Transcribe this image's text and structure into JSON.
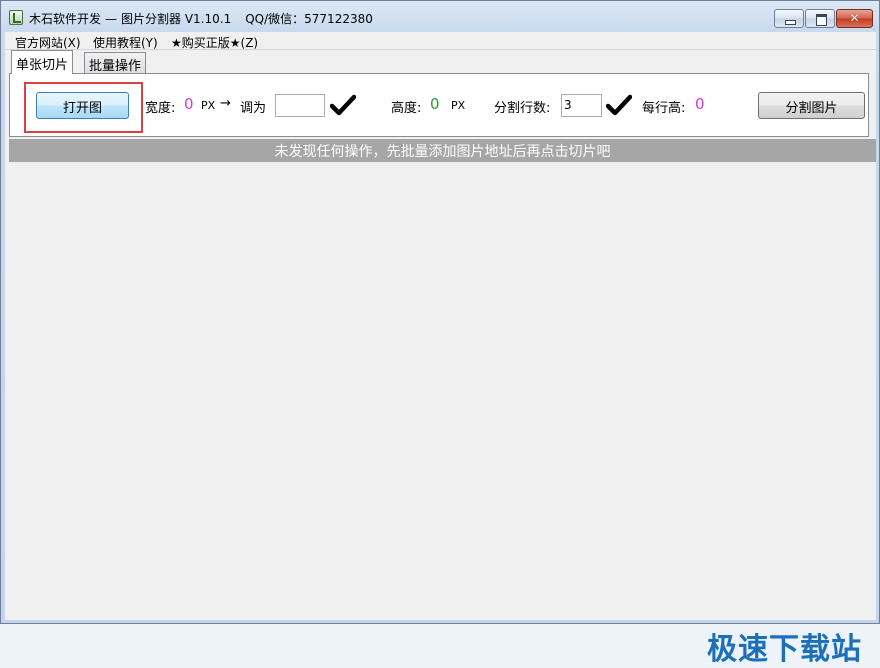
{
  "window": {
    "app_name": "木石软件开发",
    "separator": "—",
    "product": "图片分割器 V1.10.1",
    "contact": "QQ/微信：577122380"
  },
  "menu": {
    "items": [
      {
        "label": "官方网站(X)"
      },
      {
        "label": "使用教程(Y)"
      },
      {
        "label": "★购买正版★(Z)"
      }
    ]
  },
  "tabs": [
    {
      "label": "单张切片",
      "active": true
    },
    {
      "label": "批量操作",
      "active": false
    }
  ],
  "panel": {
    "open_button": "打开图",
    "width_label": "宽度:",
    "width_value": "0",
    "width_unit": "PX",
    "arrow": "→",
    "resize_label": "调为",
    "resize_value": "",
    "height_label": "高度:",
    "height_value": "0",
    "height_unit": "PX",
    "rows_label": "分割行数:",
    "rows_value": "3",
    "row_height_label": "每行高:",
    "row_height_value": "0",
    "split_button": "分割图片"
  },
  "status": {
    "message": "未发现任何操作，先批量添加图片地址后再点击切片吧"
  },
  "watermark": {
    "text": "极速下载站"
  },
  "colors": {
    "width_value": "#d63ad6",
    "height_value": "#2e9a2e",
    "row_height_value": "#d63ad6",
    "highlight": "#d9433f",
    "watermark": "#1c6fb8"
  }
}
